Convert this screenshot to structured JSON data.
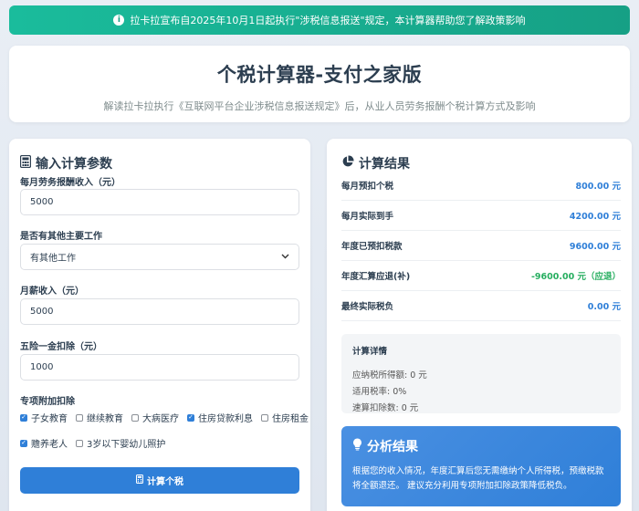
{
  "banner": {
    "text": "拉卡拉宣布自2025年10月1日起执行\"涉税信息报送\"规定，本计算器帮助您了解政策影响"
  },
  "header": {
    "title": "个税计算器-支付之家版",
    "subtitle": "解读拉卡拉执行《互联网平台企业涉税信息报送规定》后，从业人员劳务报酬个税计算方式及影响"
  },
  "input_panel": {
    "title": "输入计算参数",
    "income_label": "每月劳务报酬收入（元）",
    "income_value": "5000",
    "other_job_label": "是否有其他主要工作",
    "other_job_selected": "有其他工作",
    "salary_label": "月薪收入（元）",
    "salary_value": "5000",
    "insurance_label": "五险一金扣除（元）",
    "insurance_value": "1000",
    "deductions_label": "专项附加扣除",
    "deductions": [
      {
        "label": "子女教育",
        "checked": true
      },
      {
        "label": "继续教育",
        "checked": false
      },
      {
        "label": "大病医疗",
        "checked": false
      },
      {
        "label": "住房贷款利息",
        "checked": true
      },
      {
        "label": "住房租金",
        "checked": false
      },
      {
        "label": "赡养老人",
        "checked": true
      },
      {
        "label": "3岁以下婴幼儿照护",
        "checked": false
      }
    ],
    "calc_button": "计算个税"
  },
  "result_panel": {
    "title": "计算结果",
    "rows": [
      {
        "label": "每月预扣个税",
        "value": "800.00 元"
      },
      {
        "label": "每月实际到手",
        "value": "4200.00 元"
      },
      {
        "label": "年度已预扣税款",
        "value": "9600.00 元"
      },
      {
        "label": "年度汇算应退(补)",
        "value": "-9600.00 元（应退）"
      },
      {
        "label": "最终实际税负",
        "value": "0.00 元"
      }
    ],
    "detail": {
      "title": "计算详情",
      "taxable_income": "应纳税所得额: 0 元",
      "tax_rate": "适用税率: 0%",
      "quick_deduction": "速算扣除数: 0 元"
    }
  },
  "analysis": {
    "title": "分析结果",
    "text": "根据您的收入情况，年度汇算后您无需缴纳个人所得税，预缴税款将全额退还。 建议充分利用专项附加扣除政策降低税负。"
  },
  "colors": {
    "accent": "#2f7fd8",
    "banner": "#1abc9c",
    "refund": "#27ae60"
  }
}
